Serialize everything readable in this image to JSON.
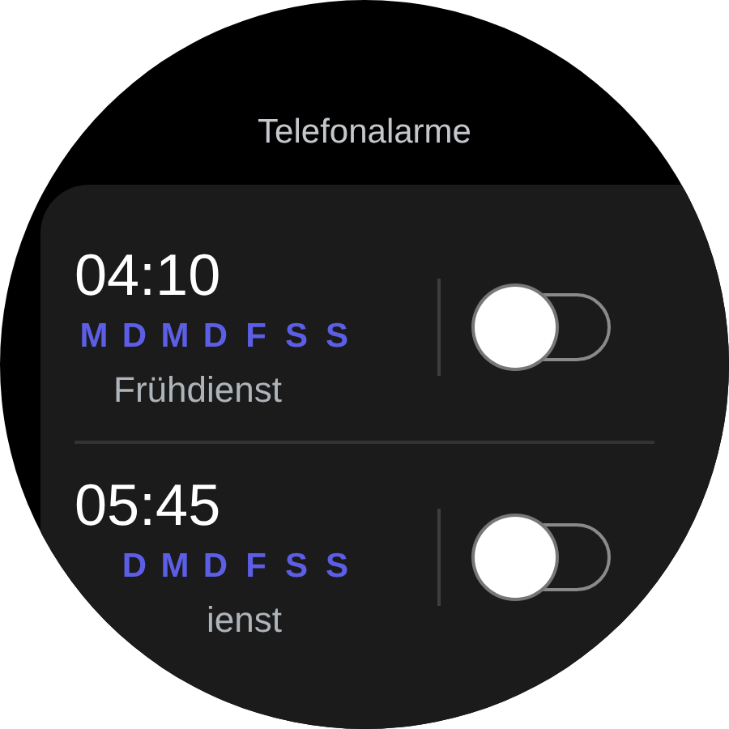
{
  "title": "Telefonalarme",
  "alarms": [
    {
      "time": "04:10",
      "days": [
        "M",
        "D",
        "M",
        "D",
        "F",
        "S",
        "S"
      ],
      "label": "Frühdienst",
      "on": false
    },
    {
      "time": "05:45",
      "days": [
        "D",
        "M",
        "D",
        "F",
        "S",
        "S"
      ],
      "label": "ienst",
      "on": false
    }
  ]
}
